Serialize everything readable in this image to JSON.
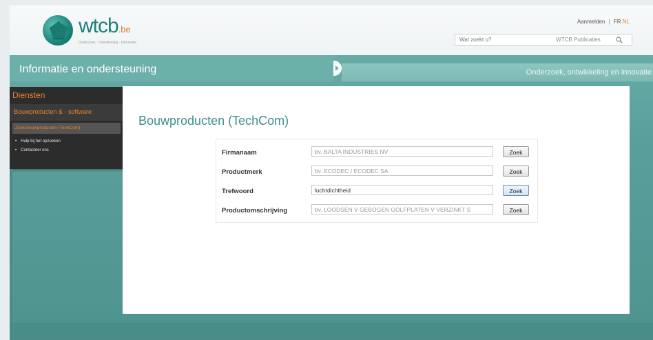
{
  "header": {
    "logo_text": "wtcb",
    "logo_suffix": ".be",
    "logo_tagline": "Onderzoek · Ontwikkeling · Informatie",
    "login": "Aanmelden",
    "lang_fr": "FR",
    "lang_nl": "NL",
    "search_placeholder": "Wat zoekt u?",
    "search_scope": "WTCB Publicaties"
  },
  "band": {
    "left_title": "Informatie en ondersteuning",
    "right_title": "Onderzoek, ontwikkeling en innovatie"
  },
  "sidebar": {
    "title": "Diensten",
    "item_main": "Bouwproducten & - software",
    "item_active": "Zoek bouwproducten (TechCom)",
    "sub_items": [
      "Hulp bij het opzoeken",
      "Contacteer ons"
    ]
  },
  "main": {
    "title": "Bouwproducten (TechCom)",
    "rows": [
      {
        "label": "Firmanaam",
        "value": "bv. BALTA INDUSTRIES NV",
        "button": "Zoek"
      },
      {
        "label": "Productmerk",
        "value": "bv. ECODEC / ECODEC SA",
        "button": "Zoek"
      },
      {
        "label": "Trefwoord",
        "value": "luchtdichtheid",
        "button": "Zoek"
      },
      {
        "label": "Productomschrijving",
        "value": "bv. LOODSEN V GEBOGEN GOLFPLATEN V VERZINKT S",
        "button": "Zoek"
      }
    ]
  },
  "colors": {
    "accent": "#e9842f",
    "teal": "#3f8f8c"
  }
}
